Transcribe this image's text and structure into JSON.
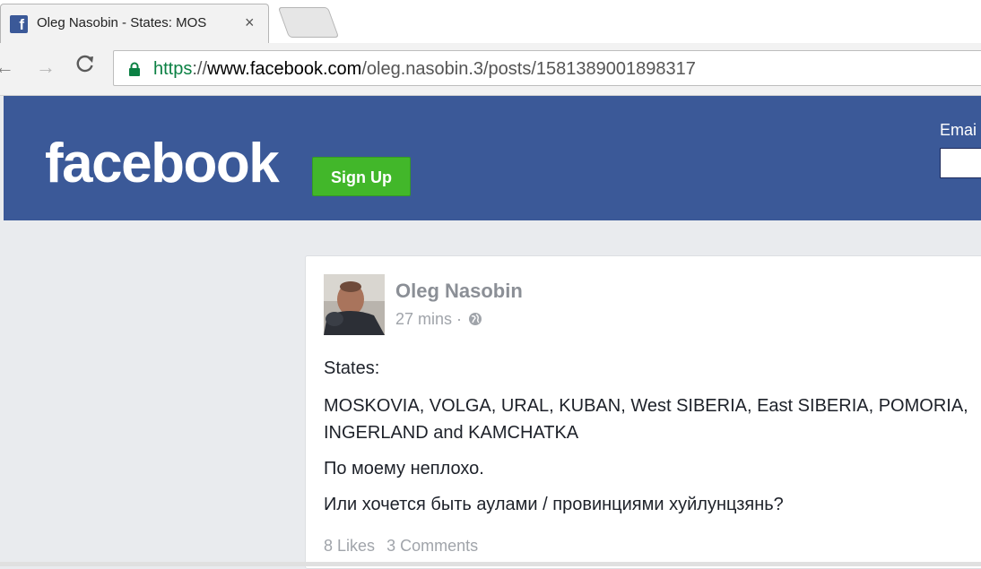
{
  "browser": {
    "tab_title": "Oleg Nasobin - States: MOS",
    "tab_close": "×",
    "url_scheme": "https",
    "url_sep": "://",
    "url_host": "www.facebook.com",
    "url_path": "/oleg.nasobin.3/posts/1581389001898317",
    "back_glyph": "←",
    "forward_glyph": "→",
    "reload_glyph": "C"
  },
  "header": {
    "logo": "facebook",
    "signup_label": "Sign Up",
    "email_label": "Emai"
  },
  "post": {
    "author": "Oleg Nasobin",
    "time": "27 mins",
    "meta_sep": "·",
    "paragraphs": [
      "States:",
      "MOSKOVIA, VOLGA, URAL, KUBAN, West SIBERIA, East SIBERIA, POMORIA, INGERLAND and KAMCHATKA",
      "По моему неплохо.",
      "Или хочется быть аулами / провинциями хуйлунцзянь?"
    ],
    "likes": "8 Likes",
    "comments": "3 Comments"
  },
  "colors": {
    "facebook_blue": "#3b5998",
    "signup_green": "#42b72a",
    "https_green": "#0b8043"
  },
  "icons": [
    "facebook-favicon",
    "lock-icon",
    "globe-icon",
    "close-icon",
    "back-icon",
    "forward-icon",
    "reload-icon"
  ]
}
